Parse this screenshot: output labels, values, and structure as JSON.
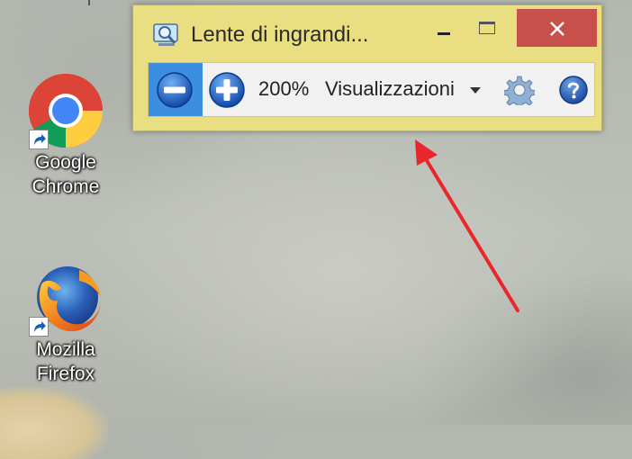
{
  "desktop": {
    "icons": [
      {
        "label_line1": "Google",
        "label_line2": "Chrome"
      },
      {
        "label_line1": "Mozilla",
        "label_line2": "Firefox"
      }
    ]
  },
  "magnifier": {
    "title": "Lente di ingrandi...",
    "zoom_percent": "200%",
    "views_label": "Visualizzazioni",
    "icons": {
      "app": "magnifier-icon",
      "zoom_out": "minus-icon",
      "zoom_in": "plus-icon",
      "options": "gear-icon",
      "help": "help-icon"
    },
    "colors": {
      "frame": "#e9df82",
      "close": "#c7504a",
      "zoom_button": "#1f6fd0",
      "active_background": "#3b8ee0"
    }
  },
  "annotation": {
    "arrow_color": "#e8262b"
  }
}
